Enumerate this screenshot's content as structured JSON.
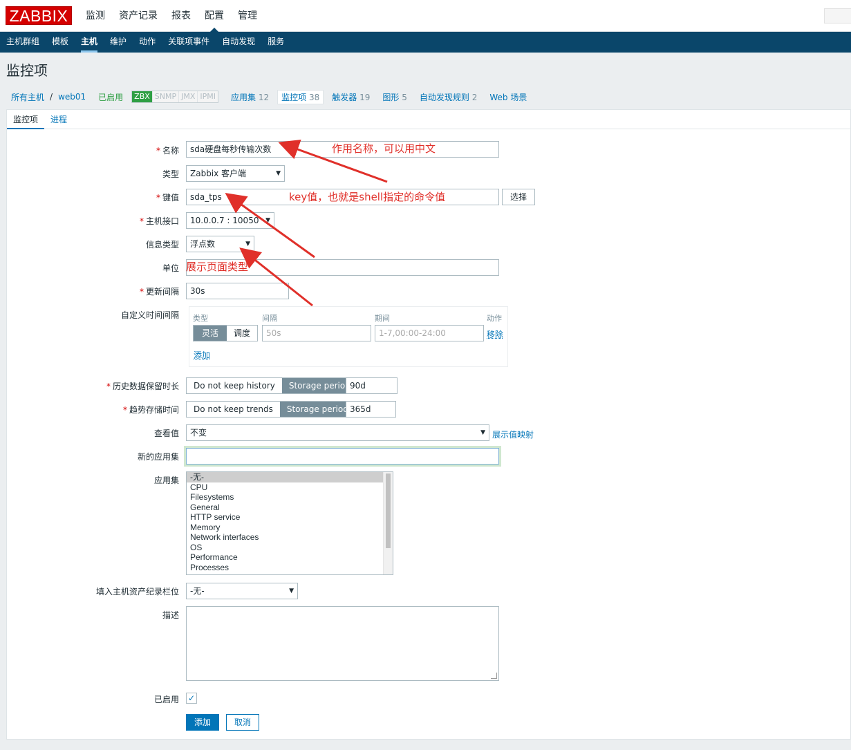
{
  "logo": "ZABBIX",
  "top_menu": [
    "监测",
    "资产记录",
    "报表",
    "配置",
    "管理"
  ],
  "sub_menu": [
    "主机群组",
    "模板",
    "主机",
    "维护",
    "动作",
    "关联项事件",
    "自动发现",
    "服务"
  ],
  "page_title": "监控项",
  "breadcrumb": {
    "all_hosts": "所有主机",
    "separator": "/",
    "host": "web01",
    "enabled": "已启用",
    "tags": [
      "ZBX",
      "SNMP",
      "JMX",
      "IPMI"
    ],
    "links": [
      {
        "label": "应用集",
        "count": "12"
      },
      {
        "label": "监控项",
        "count": "38"
      },
      {
        "label": "触发器",
        "count": "19"
      },
      {
        "label": "图形",
        "count": "5"
      },
      {
        "label": "自动发现规则",
        "count": "2"
      },
      {
        "label": "Web 场景",
        "count": ""
      }
    ]
  },
  "tabs": [
    "监控项",
    "进程"
  ],
  "form": {
    "name_label": "名称",
    "name_value": "sda硬盘每秒传输次数",
    "type_label": "类型",
    "type_value": "Zabbix 客户端",
    "key_label": "键值",
    "key_value": "sda_tps",
    "key_select_button": "选择",
    "interface_label": "主机接口",
    "interface_value": "10.0.0.7 : 10050",
    "info_type_label": "信息类型",
    "info_type_value": "浮点数",
    "unit_label": "单位",
    "interval_label": "更新间隔",
    "interval_value": "30s",
    "custom_intervals_label": "自定义时间间隔",
    "custom_intervals": {
      "col_type": "类型",
      "col_interval": "间隔",
      "col_period": "期间",
      "col_action": "动作",
      "mode_flexible": "灵活",
      "mode_scheduling": "调度",
      "interval_placeholder": "50s",
      "period_placeholder": "1-7,00:00-24:00",
      "remove": "移除",
      "add": "添加"
    },
    "history_label": "历史数据保留时长",
    "history_options": [
      "Do not keep history",
      "Storage period"
    ],
    "history_value": "90d",
    "trends_label": "趋势存储时间",
    "trends_options": [
      "Do not keep trends",
      "Storage period"
    ],
    "trends_value": "365d",
    "show_value_label": "查看值",
    "show_value": "不变",
    "show_value_link": "展示值映射",
    "new_app_label": "新的应用集",
    "new_app_value": "",
    "apps_label": "应用集",
    "apps": [
      "-无-",
      "CPU",
      "Filesystems",
      "General",
      "HTTP service",
      "Memory",
      "Network interfaces",
      "OS",
      "Performance",
      "Processes"
    ],
    "inventory_label": "填入主机资产纪录栏位",
    "inventory_value": "-无-",
    "description_label": "描述",
    "enabled_label": "已启用",
    "add_button": "添加",
    "cancel_button": "取消"
  },
  "annotations": {
    "name_note": "作用名称，可以用中文",
    "key_note": "key值，也就是shell指定的命令值",
    "type_note": "展示页面类型"
  },
  "colors": {
    "nav_bg": "#0a466a",
    "link": "#0275b8",
    "annotation": "#e0302a",
    "logo": "#d40000"
  }
}
